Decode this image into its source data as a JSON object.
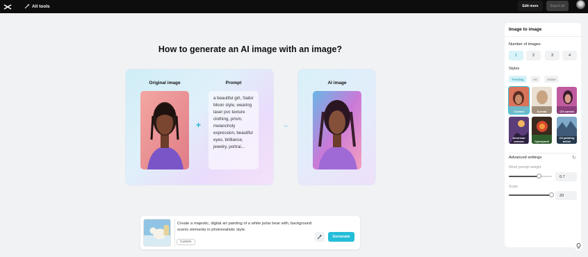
{
  "topbar": {
    "all_tools_label": "All tools",
    "edit_more_label": "Edit more",
    "export_all_label": "Export all"
  },
  "main": {
    "heading": "How to generate an AI image with an image?",
    "original_label": "Original image",
    "prompt_label": "Prompt",
    "prompt_text": "a beautiful girl, Sailor Moon style, wearing laser pvc texture clothing, prism, melancholy expression, beautiful eyes, brilliance, jewelry, portrai...",
    "ai_label": "AI image"
  },
  "prompt_bar": {
    "text": "Create a majestic, digital art painting of a white polar bear with, background scenic elements in photorealistic style.",
    "style_chip": "Custom",
    "generate_label": "Generate"
  },
  "panel": {
    "title": "Image to image",
    "number_label": "Number of images",
    "numbers": [
      "1",
      "2",
      "3",
      "4"
    ],
    "selected_number": "1",
    "styles_label": "Styles",
    "style_tabs": [
      "Trending",
      "Art",
      "Anime"
    ],
    "styles": [
      "Custom",
      "Surreal",
      "CG surreal",
      "American cartoon",
      "Cyberpunk",
      "Oil painting anime"
    ],
    "advanced_label": "Advanced settings",
    "word_weight_label": "Word prompt weight",
    "word_weight_value": "0.7",
    "scale_label": "Scale",
    "scale_value": "20"
  },
  "colors": {
    "accent": "#24bdd8",
    "topbar": "#0d0d0d"
  }
}
